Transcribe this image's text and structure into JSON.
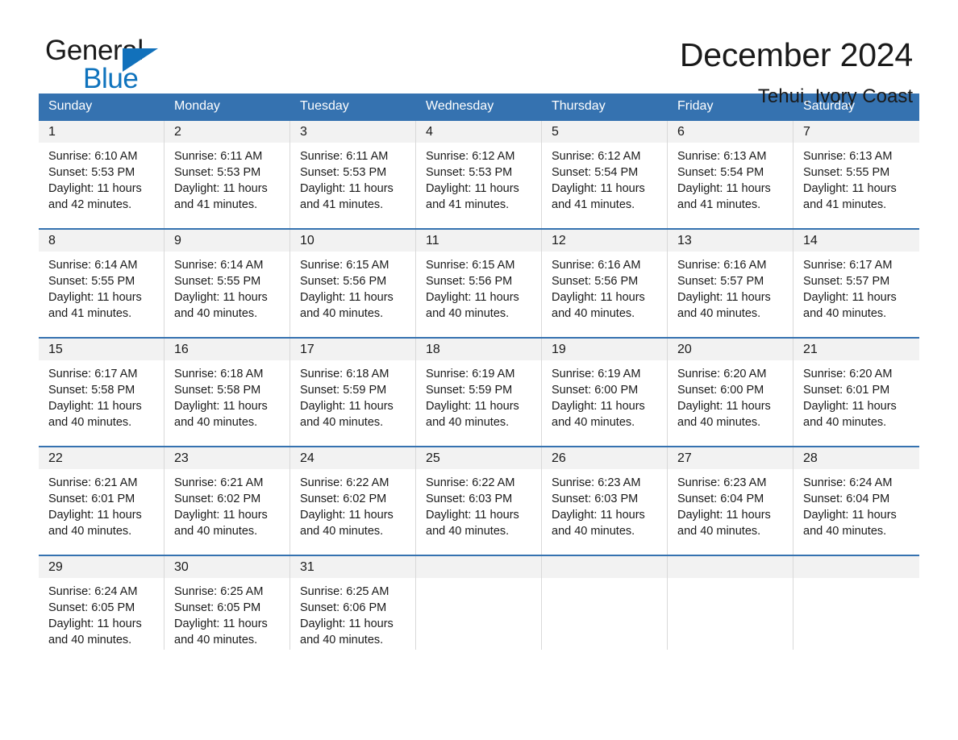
{
  "brand": {
    "name_part1": "General",
    "name_part2": "Blue",
    "triangle_color": "#1271bb",
    "blue_color": "#0f73bd"
  },
  "header": {
    "title": "December 2024",
    "location": "Tehui, Ivory Coast"
  },
  "calendar": {
    "header_bg": "#3572b0",
    "weekdays": [
      "Sunday",
      "Monday",
      "Tuesday",
      "Wednesday",
      "Thursday",
      "Friday",
      "Saturday"
    ],
    "weeks": [
      [
        {
          "day": "1",
          "sunrise": "Sunrise: 6:10 AM",
          "sunset": "Sunset: 5:53 PM",
          "daylight": "Daylight: 11 hours and 42 minutes."
        },
        {
          "day": "2",
          "sunrise": "Sunrise: 6:11 AM",
          "sunset": "Sunset: 5:53 PM",
          "daylight": "Daylight: 11 hours and 41 minutes."
        },
        {
          "day": "3",
          "sunrise": "Sunrise: 6:11 AM",
          "sunset": "Sunset: 5:53 PM",
          "daylight": "Daylight: 11 hours and 41 minutes."
        },
        {
          "day": "4",
          "sunrise": "Sunrise: 6:12 AM",
          "sunset": "Sunset: 5:53 PM",
          "daylight": "Daylight: 11 hours and 41 minutes."
        },
        {
          "day": "5",
          "sunrise": "Sunrise: 6:12 AM",
          "sunset": "Sunset: 5:54 PM",
          "daylight": "Daylight: 11 hours and 41 minutes."
        },
        {
          "day": "6",
          "sunrise": "Sunrise: 6:13 AM",
          "sunset": "Sunset: 5:54 PM",
          "daylight": "Daylight: 11 hours and 41 minutes."
        },
        {
          "day": "7",
          "sunrise": "Sunrise: 6:13 AM",
          "sunset": "Sunset: 5:55 PM",
          "daylight": "Daylight: 11 hours and 41 minutes."
        }
      ],
      [
        {
          "day": "8",
          "sunrise": "Sunrise: 6:14 AM",
          "sunset": "Sunset: 5:55 PM",
          "daylight": "Daylight: 11 hours and 41 minutes."
        },
        {
          "day": "9",
          "sunrise": "Sunrise: 6:14 AM",
          "sunset": "Sunset: 5:55 PM",
          "daylight": "Daylight: 11 hours and 40 minutes."
        },
        {
          "day": "10",
          "sunrise": "Sunrise: 6:15 AM",
          "sunset": "Sunset: 5:56 PM",
          "daylight": "Daylight: 11 hours and 40 minutes."
        },
        {
          "day": "11",
          "sunrise": "Sunrise: 6:15 AM",
          "sunset": "Sunset: 5:56 PM",
          "daylight": "Daylight: 11 hours and 40 minutes."
        },
        {
          "day": "12",
          "sunrise": "Sunrise: 6:16 AM",
          "sunset": "Sunset: 5:56 PM",
          "daylight": "Daylight: 11 hours and 40 minutes."
        },
        {
          "day": "13",
          "sunrise": "Sunrise: 6:16 AM",
          "sunset": "Sunset: 5:57 PM",
          "daylight": "Daylight: 11 hours and 40 minutes."
        },
        {
          "day": "14",
          "sunrise": "Sunrise: 6:17 AM",
          "sunset": "Sunset: 5:57 PM",
          "daylight": "Daylight: 11 hours and 40 minutes."
        }
      ],
      [
        {
          "day": "15",
          "sunrise": "Sunrise: 6:17 AM",
          "sunset": "Sunset: 5:58 PM",
          "daylight": "Daylight: 11 hours and 40 minutes."
        },
        {
          "day": "16",
          "sunrise": "Sunrise: 6:18 AM",
          "sunset": "Sunset: 5:58 PM",
          "daylight": "Daylight: 11 hours and 40 minutes."
        },
        {
          "day": "17",
          "sunrise": "Sunrise: 6:18 AM",
          "sunset": "Sunset: 5:59 PM",
          "daylight": "Daylight: 11 hours and 40 minutes."
        },
        {
          "day": "18",
          "sunrise": "Sunrise: 6:19 AM",
          "sunset": "Sunset: 5:59 PM",
          "daylight": "Daylight: 11 hours and 40 minutes."
        },
        {
          "day": "19",
          "sunrise": "Sunrise: 6:19 AM",
          "sunset": "Sunset: 6:00 PM",
          "daylight": "Daylight: 11 hours and 40 minutes."
        },
        {
          "day": "20",
          "sunrise": "Sunrise: 6:20 AM",
          "sunset": "Sunset: 6:00 PM",
          "daylight": "Daylight: 11 hours and 40 minutes."
        },
        {
          "day": "21",
          "sunrise": "Sunrise: 6:20 AM",
          "sunset": "Sunset: 6:01 PM",
          "daylight": "Daylight: 11 hours and 40 minutes."
        }
      ],
      [
        {
          "day": "22",
          "sunrise": "Sunrise: 6:21 AM",
          "sunset": "Sunset: 6:01 PM",
          "daylight": "Daylight: 11 hours and 40 minutes."
        },
        {
          "day": "23",
          "sunrise": "Sunrise: 6:21 AM",
          "sunset": "Sunset: 6:02 PM",
          "daylight": "Daylight: 11 hours and 40 minutes."
        },
        {
          "day": "24",
          "sunrise": "Sunrise: 6:22 AM",
          "sunset": "Sunset: 6:02 PM",
          "daylight": "Daylight: 11 hours and 40 minutes."
        },
        {
          "day": "25",
          "sunrise": "Sunrise: 6:22 AM",
          "sunset": "Sunset: 6:03 PM",
          "daylight": "Daylight: 11 hours and 40 minutes."
        },
        {
          "day": "26",
          "sunrise": "Sunrise: 6:23 AM",
          "sunset": "Sunset: 6:03 PM",
          "daylight": "Daylight: 11 hours and 40 minutes."
        },
        {
          "day": "27",
          "sunrise": "Sunrise: 6:23 AM",
          "sunset": "Sunset: 6:04 PM",
          "daylight": "Daylight: 11 hours and 40 minutes."
        },
        {
          "day": "28",
          "sunrise": "Sunrise: 6:24 AM",
          "sunset": "Sunset: 6:04 PM",
          "daylight": "Daylight: 11 hours and 40 minutes."
        }
      ],
      [
        {
          "day": "29",
          "sunrise": "Sunrise: 6:24 AM",
          "sunset": "Sunset: 6:05 PM",
          "daylight": "Daylight: 11 hours and 40 minutes."
        },
        {
          "day": "30",
          "sunrise": "Sunrise: 6:25 AM",
          "sunset": "Sunset: 6:05 PM",
          "daylight": "Daylight: 11 hours and 40 minutes."
        },
        {
          "day": "31",
          "sunrise": "Sunrise: 6:25 AM",
          "sunset": "Sunset: 6:06 PM",
          "daylight": "Daylight: 11 hours and 40 minutes."
        },
        {
          "day": "",
          "sunrise": "",
          "sunset": "",
          "daylight": ""
        },
        {
          "day": "",
          "sunrise": "",
          "sunset": "",
          "daylight": ""
        },
        {
          "day": "",
          "sunrise": "",
          "sunset": "",
          "daylight": ""
        },
        {
          "day": "",
          "sunrise": "",
          "sunset": "",
          "daylight": ""
        }
      ]
    ]
  }
}
